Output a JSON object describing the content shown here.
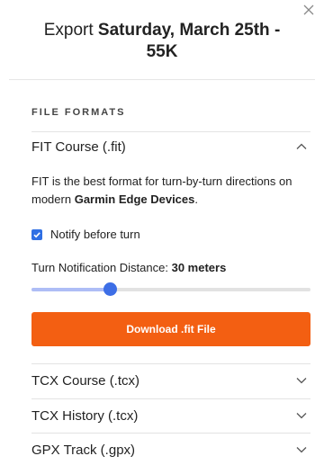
{
  "header": {
    "title_prefix": "Export ",
    "title_bold": "Saturday, March 25th - 55K"
  },
  "formats": {
    "section_label": "FILE FORMATS",
    "fit": {
      "label": "FIT Course (.fit)",
      "desc_prefix": "FIT is the best format for turn-by-turn directions on modern ",
      "desc_bold": "Garmin Edge Devices",
      "desc_suffix": ".",
      "notify_label": "Notify before turn",
      "notify_checked": true,
      "distance_prefix": "Turn Notification Distance: ",
      "distance_value": "30 meters",
      "slider_fraction": 0.28,
      "download_label": "Download .fit File",
      "accent_color": "#f35f12"
    },
    "others": [
      {
        "label": "TCX Course (.tcx)"
      },
      {
        "label": "TCX History (.tcx)"
      },
      {
        "label": "GPX Track (.gpx)"
      }
    ]
  }
}
